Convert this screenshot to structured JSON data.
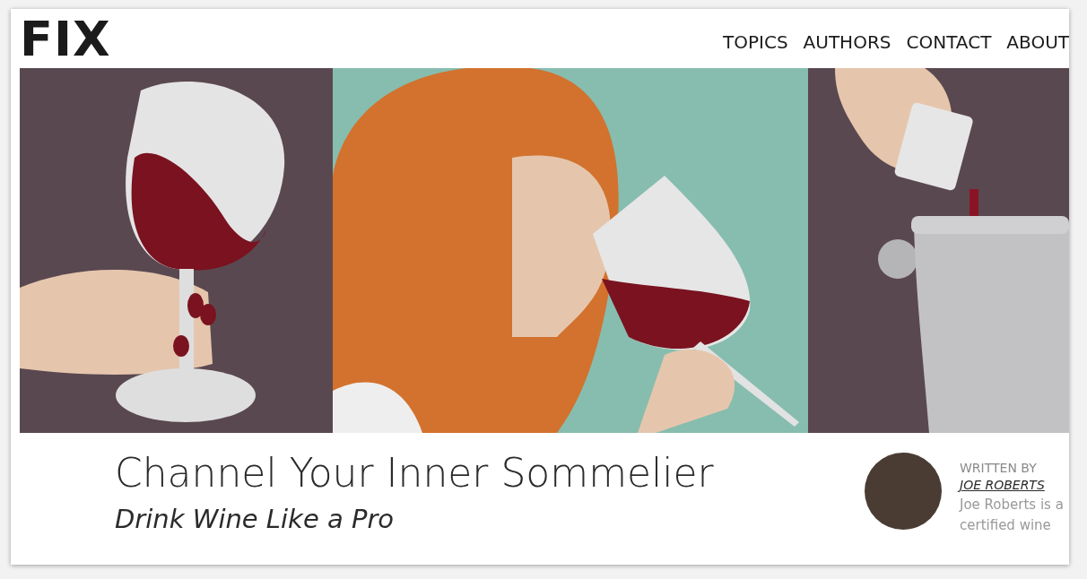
{
  "logo": "FIX",
  "nav": [
    "TOPICS",
    "AUTHORS",
    "CONTACT",
    "ABOUT"
  ],
  "article": {
    "title": "Channel Your Inner Sommelier",
    "subtitle": "Drink Wine Like a Pro"
  },
  "author": {
    "label": "WRITTEN BY",
    "name": "JOE ROBERTS",
    "bio": "Joe Roberts is a certified wine"
  }
}
